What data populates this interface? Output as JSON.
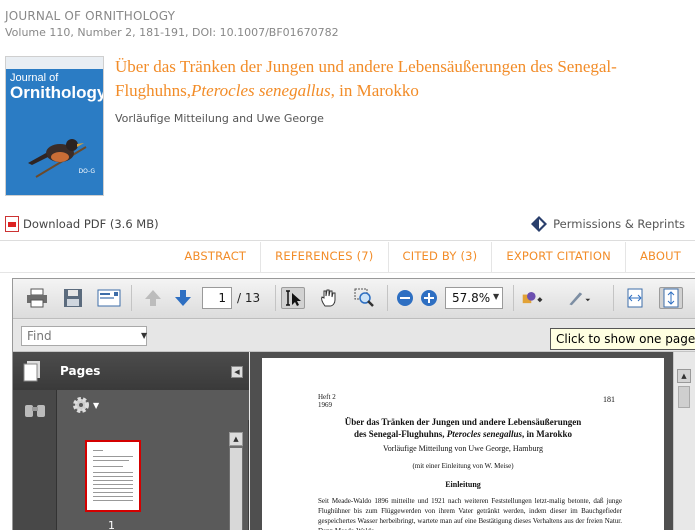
{
  "header": {
    "journal_name": "JOURNAL OF ORNITHOLOGY",
    "volume_line": "Volume 110, Number 2, 181-191, DOI: 10.1007/BF01670782"
  },
  "cover": {
    "title_line1": "Journal of",
    "title_line2": "Ornithology",
    "corner_text": "DO-G"
  },
  "article": {
    "title_part1": "Über das Tränken der Jungen und andere Lebensäußerungen des Senegal-Flughuhns,",
    "title_italic": "Pterocles senegallus",
    "title_part2": ", in Marokko",
    "authors": "Vorläufige Mitteilung and Uwe George"
  },
  "actions": {
    "download_label": "Download PDF (3.6 MB)",
    "permissions_label": "Permissions & Reprints"
  },
  "tabs": [
    {
      "label": "ABSTRACT"
    },
    {
      "label": "REFERENCES (7)"
    },
    {
      "label": "CITED BY (3)"
    },
    {
      "label": "EXPORT CITATION"
    },
    {
      "label": "ABOUT"
    }
  ],
  "viewer": {
    "current_page": "1",
    "page_of": "/ 13",
    "zoom": "57.8%",
    "find_placeholder": "Find",
    "tooltip": "Click to show one page a",
    "pages_panel_title": "Pages",
    "thumbnail_label": "1",
    "colors": {
      "accent": "#f28c28",
      "thumb_border": "#d40000"
    }
  },
  "document": {
    "heft": "Heft 2",
    "year": "1969",
    "page_number": "181",
    "title_line1": "Über das Tränken der Jungen und andere Lebensäußerungen",
    "title_line2_a": "des Senegal-Flughuhns, ",
    "title_line2_italic": "Pterocles senegallus",
    "title_line2_b": ", in Marokko",
    "author_line": "Vorläufige Mitteilung von Uwe George, Hamburg",
    "assist_line": "(mit einer Einleitung von W. Meise)",
    "heading": "Einleitung",
    "body": "Seit Meade-Waldo 1896 mitteilte und 1921 nach weiteren Feststellungen letzt-malig betonte, daß junge Flughühner bis zum Flüggewerden von ihrem Vater getränkt werden, indem dieser im Bauchgefieder gespeichertes Wasser herbeibringt, wartete man auf eine Bestätigung dieses Verhaltens aus der freien Natur. Denn Meade-Waldo"
  }
}
